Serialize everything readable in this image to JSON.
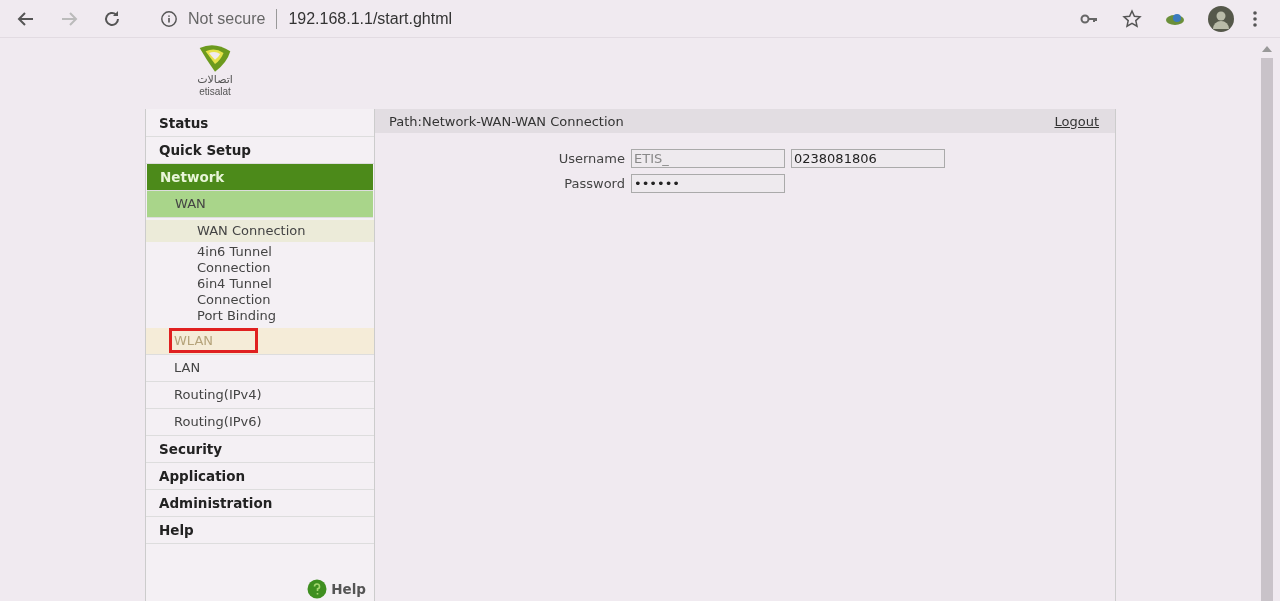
{
  "browser": {
    "security": "Not secure",
    "url": "192.168.1.1/start.ghtml"
  },
  "logo": {
    "arabic": "اتصالات",
    "latin": "etisalat"
  },
  "sidebar": {
    "items": [
      {
        "label": "Status",
        "selected": false
      },
      {
        "label": "Quick Setup",
        "selected": false
      },
      {
        "label": "Network",
        "selected": true,
        "children": [
          {
            "label": "WAN",
            "selected": true,
            "hovered": false,
            "marked": false,
            "children": [
              {
                "label": "WAN Connection",
                "selected": true
              },
              {
                "label": "4in6 Tunnel Connection",
                "selected": false
              },
              {
                "label": "6in4 Tunnel Connection",
                "selected": false
              },
              {
                "label": "Port Binding",
                "selected": false
              }
            ]
          },
          {
            "label": "WLAN",
            "selected": false,
            "hovered": true,
            "marked": true
          },
          {
            "label": "LAN",
            "selected": false,
            "hovered": false,
            "marked": false
          },
          {
            "label": "Routing(IPv4)",
            "selected": false,
            "hovered": false,
            "marked": false
          },
          {
            "label": "Routing(IPv6)",
            "selected": false,
            "hovered": false,
            "marked": false
          }
        ]
      },
      {
        "label": "Security",
        "selected": false
      },
      {
        "label": "Application",
        "selected": false
      },
      {
        "label": "Administration",
        "selected": false
      },
      {
        "label": "Help",
        "selected": false
      }
    ],
    "help_link": "Help"
  },
  "content": {
    "path": "Path:Network-WAN-WAN Connection",
    "logout": "Logout",
    "fields": [
      {
        "label": "Username",
        "inputs": [
          {
            "value": "ETIS_",
            "disabled": true
          },
          {
            "value": "0238081806",
            "disabled": false
          }
        ]
      },
      {
        "label": "Password",
        "inputs": [
          {
            "value": "••••••",
            "disabled": false
          }
        ]
      }
    ]
  }
}
